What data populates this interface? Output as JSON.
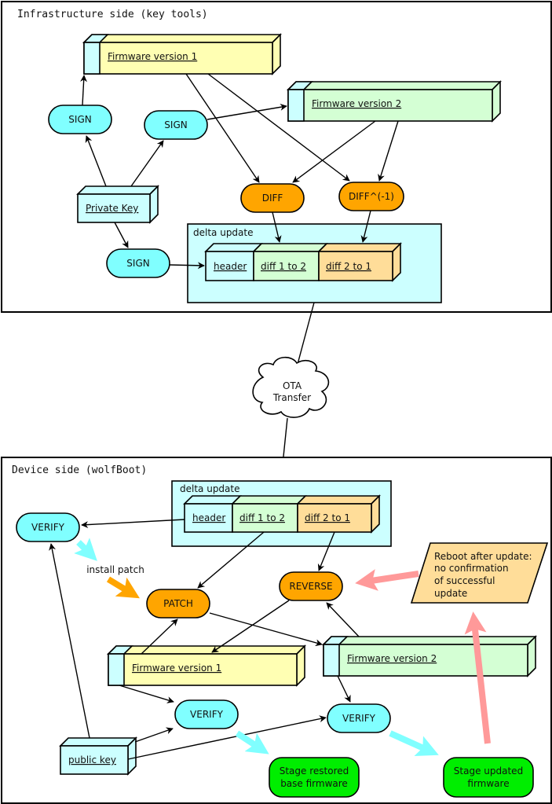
{
  "colors": {
    "sign": "#80ffff",
    "lightcyan": "#ccffff",
    "fw1": "#ffffb3",
    "fw2": "#d4ffd4",
    "diff": "#ffa500",
    "diff21": "#ffdd99",
    "stage": "#00ee00",
    "pink": "#ff9999",
    "note": "#ffdd99"
  },
  "infra": {
    "title": "Infrastructure side (key tools)",
    "fw1": "Firmware version 1",
    "fw2": "Firmware version 2",
    "sign": "SIGN",
    "private_key": "Private Key",
    "diff": "DIFF",
    "diff_inv": "DIFF^(-1)",
    "delta": {
      "label": "delta update",
      "header": "header",
      "d12": "diff 1 to 2",
      "d21": "diff 2 to 1"
    }
  },
  "cloud": {
    "line1": "OTA",
    "line2": "Transfer"
  },
  "device": {
    "title": "Device side (wolfBoot)",
    "delta": {
      "label": "delta update",
      "header": "header",
      "d12": "diff 1 to 2",
      "d21": "diff 2 to 1"
    },
    "verify": "VERIFY",
    "install_patch": "install patch",
    "patch": "PATCH",
    "reverse": "REVERSE",
    "note": [
      "Reboot after update:",
      "no confirmation",
      "of successful",
      "update"
    ],
    "fw1": "Firmware version 1",
    "fw2": "Firmware version 2",
    "public_key": "public key",
    "stage_restored": [
      "Stage restored",
      "base firmware"
    ],
    "stage_updated": [
      "Stage updated",
      "firmware"
    ]
  }
}
